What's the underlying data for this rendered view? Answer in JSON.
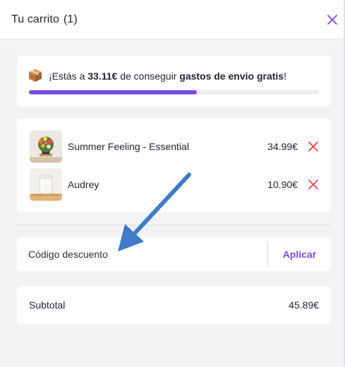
{
  "header": {
    "title": "Tu carrito",
    "count": "(1)"
  },
  "shipping": {
    "prefix": "¡Estás a ",
    "amount": "33.11€",
    "middle": " de conseguir ",
    "highlight": "gastos de envio gratis",
    "suffix": "!",
    "progress_percent": 58,
    "icon": "package-icon"
  },
  "items": [
    {
      "name": "Summer Feeling - Essential",
      "price": "34.99€",
      "thumbnail": "flower-bouquet-vase"
    },
    {
      "name": "Audrey",
      "price": "10.90€",
      "thumbnail": "glass-vase"
    }
  ],
  "discount": {
    "placeholder": "Código descuento",
    "apply_label": "Aplicar"
  },
  "subtotal": {
    "label": "Subtotal",
    "value": "45.89€"
  },
  "colors": {
    "accent": "#7a4bdf",
    "remove": "#e8404b",
    "annotation_arrow": "#3f7bc8"
  }
}
